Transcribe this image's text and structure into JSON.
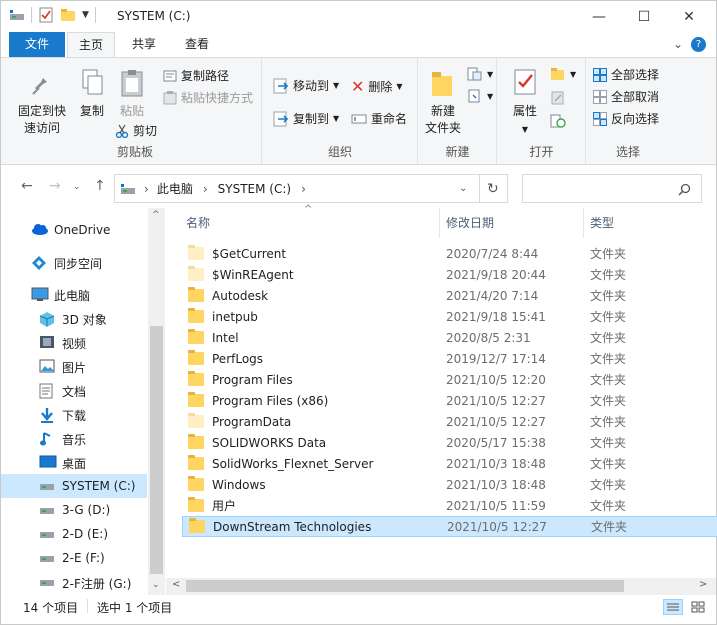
{
  "window": {
    "title": "SYSTEM (C:)",
    "minimize": "—",
    "maximize": "☐",
    "close": "✕"
  },
  "tabs": {
    "file": "文件",
    "home": "主页",
    "share": "共享",
    "view": "查看",
    "chevron": "⌄",
    "help": "?"
  },
  "ribbon": {
    "clipboard": {
      "label": "剪贴板",
      "pin_line1": "固定到快",
      "pin_line2": "速访问",
      "copy": "复制",
      "paste": "粘贴",
      "copy_path": "复制路径",
      "paste_shortcut": "粘贴快捷方式",
      "cut": "剪切"
    },
    "organize": {
      "label": "组织",
      "move_to": "移动到",
      "copy_to": "复制到",
      "delete": "删除",
      "rename": "重命名"
    },
    "new": {
      "label": "新建",
      "new_folder_line1": "新建",
      "new_folder_line2": "文件夹"
    },
    "open": {
      "label": "打开",
      "properties": "属性"
    },
    "select": {
      "label": "选择",
      "select_all": "全部选择",
      "select_none": "全部取消",
      "invert": "反向选择"
    }
  },
  "address": {
    "crumb1": "此电脑",
    "crumb2": "SYSTEM (C:)",
    "sep": "›",
    "search_placeholder": ""
  },
  "sidebar": {
    "items": [
      {
        "label": "OneDrive",
        "icon": "cloud-icon"
      },
      {
        "label": "同步空间",
        "icon": "sync-space-icon"
      },
      {
        "label": "此电脑",
        "icon": "computer-icon"
      },
      {
        "label": "3D 对象",
        "icon": "cube-icon"
      },
      {
        "label": "视频",
        "icon": "video-icon"
      },
      {
        "label": "图片",
        "icon": "picture-icon"
      },
      {
        "label": "文档",
        "icon": "document-icon"
      },
      {
        "label": "下载",
        "icon": "download-icon"
      },
      {
        "label": "音乐",
        "icon": "music-icon"
      },
      {
        "label": "桌面",
        "icon": "desktop-icon"
      },
      {
        "label": "SYSTEM (C:)",
        "icon": "drive-icon"
      },
      {
        "label": "3-G (D:)",
        "icon": "drive-icon"
      },
      {
        "label": "2-D (E:)",
        "icon": "drive-icon"
      },
      {
        "label": "2-E (F:)",
        "icon": "drive-icon"
      },
      {
        "label": "2-F注册 (G:)",
        "icon": "drive-icon"
      }
    ]
  },
  "columns": {
    "name": "名称",
    "modified": "修改日期",
    "type": "类型"
  },
  "files": [
    {
      "name": "$GetCurrent",
      "date": "2020/7/24 8:44",
      "type": "文件夹"
    },
    {
      "name": "$WinREAgent",
      "date": "2021/9/18 20:44",
      "type": "文件夹"
    },
    {
      "name": "Autodesk",
      "date": "2021/4/20 7:14",
      "type": "文件夹"
    },
    {
      "name": "inetpub",
      "date": "2021/9/18 15:41",
      "type": "文件夹"
    },
    {
      "name": "Intel",
      "date": "2020/8/5 2:31",
      "type": "文件夹"
    },
    {
      "name": "PerfLogs",
      "date": "2019/12/7 17:14",
      "type": "文件夹"
    },
    {
      "name": "Program Files",
      "date": "2021/10/5 12:20",
      "type": "文件夹"
    },
    {
      "name": "Program Files (x86)",
      "date": "2021/10/5 12:27",
      "type": "文件夹"
    },
    {
      "name": "ProgramData",
      "date": "2021/10/5 12:27",
      "type": "文件夹"
    },
    {
      "name": "SOLIDWORKS Data",
      "date": "2020/5/17 15:38",
      "type": "文件夹"
    },
    {
      "name": "SolidWorks_Flexnet_Server",
      "date": "2021/10/3 18:48",
      "type": "文件夹"
    },
    {
      "name": "Windows",
      "date": "2021/10/3 18:48",
      "type": "文件夹"
    },
    {
      "name": "用户",
      "date": "2021/10/5 11:59",
      "type": "文件夹"
    },
    {
      "name": "DownStream Technologies",
      "date": "2021/10/5 12:27",
      "type": "文件夹"
    }
  ],
  "status": {
    "count": "14 个项目",
    "selected": "选中 1 个项目"
  },
  "colors": {
    "accent": "#1979ca",
    "selection": "#cce8ff",
    "folder": "#ffd561"
  }
}
